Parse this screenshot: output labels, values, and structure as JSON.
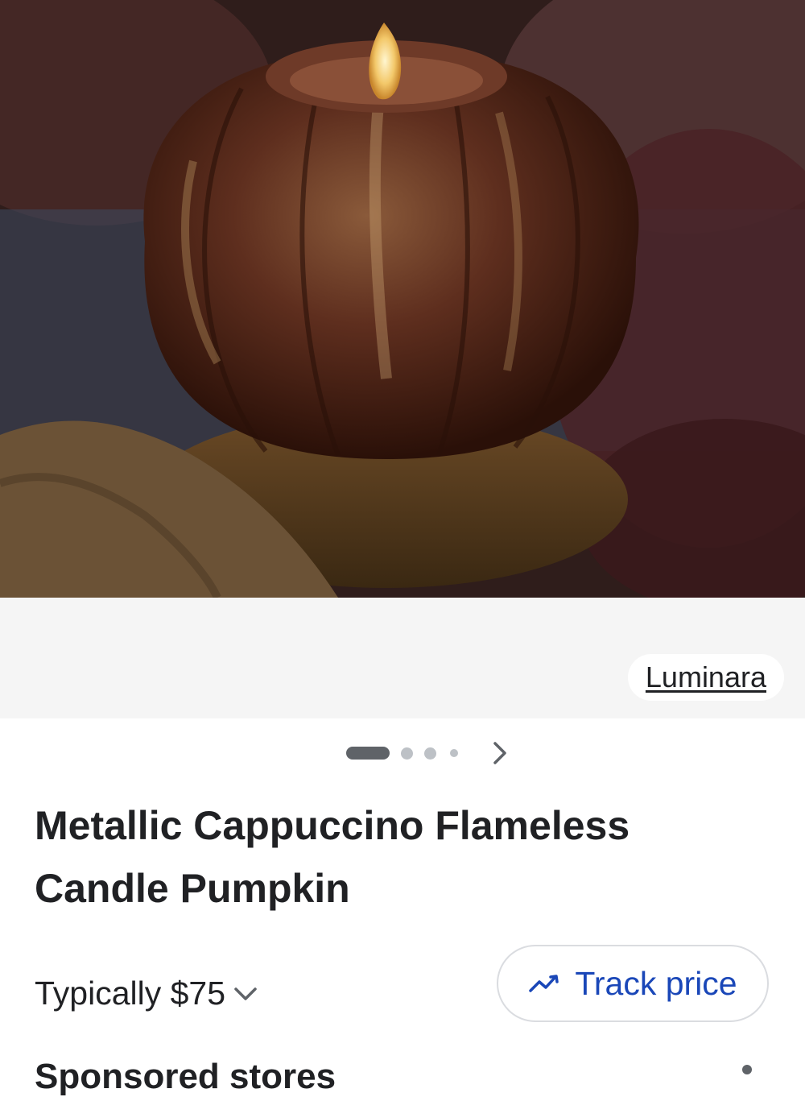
{
  "product": {
    "brand": "Luminara",
    "title": "Metallic Cappuccino Flameless Candle Pumpkin",
    "image_alt": "pumpkin candle photo",
    "carousel": {
      "total": 4,
      "active": 1
    }
  },
  "pricing": {
    "typical_label": "Typically $75",
    "track_price_label": "Track price"
  },
  "next_section": {
    "heading": "Sponsored stores"
  },
  "colors": {
    "accent": "#1a47b8",
    "text": "#202124",
    "band": "#f5f5f5"
  },
  "icons": [
    "chevron-right-icon",
    "chevron-down-icon",
    "trending-icon",
    "more-vert-icon"
  ]
}
